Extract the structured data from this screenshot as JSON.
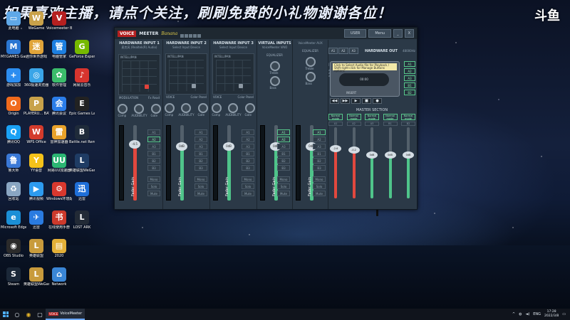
{
  "overlay": {
    "banner": "如果喜欢主播，请点个关注，刷刷免费的小礼物谢谢各位！",
    "logo": "斗鱼"
  },
  "desktop_icons": [
    {
      "label": "此电脑",
      "color": "#5fa8e8",
      "glyph": "▭",
      "col": 0,
      "row": 0
    },
    {
      "label": "WeGame",
      "color": "#c9a24a",
      "glyph": "W",
      "col": 1,
      "row": 0
    },
    {
      "label": "Voicemeeter Banana",
      "color": "#b52020",
      "glyph": "V",
      "col": 2,
      "row": 0
    },
    {
      "label": "MY.GAMES GameCenter",
      "color": "#2a76d2",
      "glyph": "M",
      "col": 0,
      "row": 1
    },
    {
      "label": "迷你世界游戏",
      "color": "#e0a43a",
      "glyph": "迷",
      "col": 1,
      "row": 1
    },
    {
      "label": "电脑管家",
      "color": "#1d7fe0",
      "glyph": "管",
      "col": 2,
      "row": 1
    },
    {
      "label": "GeForce Experience",
      "color": "#76b900",
      "glyph": "G",
      "col": 3,
      "row": 1
    },
    {
      "label": "游戏加加",
      "color": "#2c8df0",
      "glyph": "+",
      "col": 0,
      "row": 2
    },
    {
      "label": "360极速浏览器",
      "color": "#3aa5e8",
      "glyph": "◎",
      "col": 1,
      "row": 2
    },
    {
      "label": "软件管理",
      "color": "#3bbd6b",
      "glyph": "✿",
      "col": 2,
      "row": 2
    },
    {
      "label": "网易云音乐",
      "color": "#d7342e",
      "glyph": "♪",
      "col": 3,
      "row": 2
    },
    {
      "label": "Origin",
      "color": "#f06a1c",
      "glyph": "O",
      "col": 0,
      "row": 3
    },
    {
      "label": "PLAYERU... BATTLEGR...",
      "color": "#c8a24a",
      "glyph": "P",
      "col": 1,
      "row": 3
    },
    {
      "label": "腾讯会议",
      "color": "#2b7de9",
      "glyph": "会",
      "col": 2,
      "row": 3
    },
    {
      "label": "Epic Games Launcher",
      "color": "#222222",
      "glyph": "E",
      "col": 3,
      "row": 3
    },
    {
      "label": "腾讯QQ",
      "color": "#1aa1f5",
      "glyph": "Q",
      "col": 0,
      "row": 4
    },
    {
      "label": "WPS Office",
      "color": "#d33b2c",
      "glyph": "W",
      "col": 1,
      "row": 4
    },
    {
      "label": "雷神加速器",
      "color": "#e9a22a",
      "glyph": "雷",
      "col": 2,
      "row": 4
    },
    {
      "label": "Battle.net Remaster...",
      "color": "#1f2b3a",
      "glyph": "B",
      "col": 3,
      "row": 4
    },
    {
      "label": "鲁大师",
      "color": "#3a78d6",
      "glyph": "鲁",
      "col": 0,
      "row": 5
    },
    {
      "label": "YY语音",
      "color": "#f4c21a",
      "glyph": "Y",
      "col": 1,
      "row": 5
    },
    {
      "label": "网易UU加速器",
      "color": "#2bb673",
      "glyph": "UU",
      "col": 2,
      "row": 5
    },
    {
      "label": "英雄联盟WeGame版",
      "color": "#1f3c64",
      "glyph": "L",
      "col": 3,
      "row": 5
    },
    {
      "label": "回收站",
      "color": "#8aa6c2",
      "glyph": "♻",
      "col": 0,
      "row": 6
    },
    {
      "label": "腾讯视频",
      "color": "#2d9bef",
      "glyph": "▶",
      "col": 1,
      "row": 6
    },
    {
      "label": "Windows环境配置",
      "color": "#d8382e",
      "glyph": "⚙",
      "col": 2,
      "row": 6
    },
    {
      "label": "迅雷",
      "color": "#1f6fd8",
      "glyph": "迅",
      "col": 3,
      "row": 6
    },
    {
      "label": "Microsoft Edge",
      "color": "#1b8fd6",
      "glyph": "e",
      "col": 0,
      "row": 7
    },
    {
      "label": "迅雷",
      "color": "#2a7be0",
      "glyph": "✈",
      "col": 1,
      "row": 7
    },
    {
      "label": "在线使用手册",
      "color": "#cc3a2c",
      "glyph": "书",
      "col": 2,
      "row": 7
    },
    {
      "label": "LOST ARK",
      "color": "#222a36",
      "glyph": "L",
      "col": 3,
      "row": 7
    },
    {
      "label": "OBS Studio",
      "color": "#2b2b2b",
      "glyph": "◉",
      "col": 0,
      "row": 8
    },
    {
      "label": "英雄联盟",
      "color": "#c89b3c",
      "glyph": "L",
      "col": 1,
      "row": 8
    },
    {
      "label": "2020",
      "color": "#e3b038",
      "glyph": "▤",
      "col": 2,
      "row": 8
    },
    {
      "label": "Steam",
      "color": "#1b2838",
      "glyph": "S",
      "col": 0,
      "row": 9
    },
    {
      "label": "英雄联盟WeGame版",
      "color": "#c89b3c",
      "glyph": "L",
      "col": 1,
      "row": 9
    },
    {
      "label": "Network",
      "color": "#3a86d6",
      "glyph": "⌂",
      "col": 2,
      "row": 9
    }
  ],
  "voicemeeter": {
    "brand": "VOICE",
    "brand2": "MEETER",
    "variant": "Banana",
    "user_btn": "USER",
    "menu_btn": "Menu",
    "minimize": "_",
    "close": "X",
    "strips": [
      {
        "title": "HARDWARE INPUT 1",
        "device": "麦克风 (Realtek(R) Audio)",
        "intelli": "INTELLIPAN",
        "mode": "MODULATION",
        "mode2": "Fx Read",
        "knob1": "Comp",
        "knob2": "AUDIBILITY",
        "knob3": "Gate",
        "gain": "-4.5",
        "fill": "#e2483e",
        "level": 0.78,
        "routes": [
          "A1",
          "A2",
          "A3",
          "B1",
          "B2",
          "B3",
          "Mono",
          "Solo",
          "Mute"
        ],
        "on": [
          1
        ]
      },
      {
        "title": "HARDWARE INPUT 2",
        "device": "Select Input Device",
        "intelli": "INTELLIPAN",
        "mode": "VOICE",
        "mode2": "Color Panel",
        "knob1": "Comp",
        "knob2": "AUDIBILITY",
        "knob3": "Gate",
        "gain": "0dB",
        "fill": "#4fc48a",
        "level": 0.74,
        "routes": [
          "A1",
          "A2",
          "A3",
          "B1",
          "B2",
          "B3",
          "Mono",
          "Solo",
          "Mute"
        ],
        "on": []
      },
      {
        "title": "HARDWARE INPUT 3",
        "device": "Select Input Device",
        "intelli": "INTELLIPAN",
        "mode": "VOICE",
        "mode2": "Color Panel",
        "knob1": "Comp",
        "knob2": "AUDIBILITY",
        "knob3": "Gate",
        "gain": "0dB",
        "fill": "#4fc48a",
        "level": 0.74,
        "routes": [
          "A1",
          "A2",
          "A3",
          "B1",
          "B2",
          "B3",
          "Mono",
          "Solo",
          "Mute"
        ],
        "on": []
      },
      {
        "title": "VIRTUAL INPUTS",
        "device": "VoiceMeeter VAIO",
        "intelli": "EQUALIZER",
        "mode": "Treble",
        "mode2": "Bass",
        "knob1": "",
        "knob2": "",
        "knob3": "",
        "gain": "0dB",
        "fill": "#4fc48a",
        "level": 0.74,
        "routes": [
          "A1",
          "A2",
          "A3",
          "B1",
          "B2",
          "B3",
          "Mono",
          "Solo",
          "Mute"
        ],
        "on": [
          0,
          1
        ]
      },
      {
        "title": "",
        "device": "VoiceMeeter AUX",
        "intelli": "EQUALIZER",
        "mode": "Treble",
        "mode2": "Bass",
        "knob1": "",
        "knob2": "",
        "knob3": "",
        "gain": "0dB",
        "fill": "#4fc48a",
        "level": 0.74,
        "routes": [
          "A1",
          "A2",
          "A3",
          "B1",
          "B2",
          "B3",
          "Mono",
          "Solo",
          "Mute"
        ],
        "on": [
          0
        ]
      }
    ],
    "hardware_out": {
      "title": "HARDWARE OUT",
      "spec": "48000Hz | 512",
      "devices": [
        "A1: 耳机 (Realtek(R) Audio)",
        "A2: VAIO3 (VB-Audio...)",
        "A3: 扬声器 (NVIDIA High Definition Audio)"
      ],
      "a_buttons": [
        "A1",
        "A2",
        "A3"
      ],
      "tape_note": "Click to Select Audio file for Playback / Shift-right-click for Manage Buttons options",
      "tape_time": "00:00",
      "tape_label": "INSERT",
      "ctrls": [
        "◀◀",
        "▶▶",
        "▶",
        "■",
        "●"
      ],
      "bus_buttons": [
        "A1",
        "A2",
        "A3",
        "B1",
        "B2"
      ],
      "master_label": "MASTER SECTION",
      "modes": [
        "Normal mode",
        "Normal mode",
        "Normal mode",
        "Normal mode",
        "Normal mode"
      ],
      "columns": [
        "A1",
        "A2",
        "A3",
        "B1",
        "B2"
      ],
      "gains": [
        {
          "val": "-2.6",
          "fill": "#e2483e",
          "level": 0.72
        },
        {
          "val": "-0.2",
          "fill": "#e2483e",
          "level": 0.7
        },
        {
          "val": "0dB",
          "fill": "#4fc48a",
          "level": 0.62
        },
        {
          "val": "0dB",
          "fill": "#4fc48a",
          "level": 0.62
        },
        {
          "val": "0dB",
          "fill": "#4fc48a",
          "level": 0.62
        }
      ],
      "fader_label": "Fader Gain"
    }
  },
  "taskbar": {
    "app_label": "VoiceMeeter",
    "app_icon": "VOICE",
    "tray_lang": "ENG",
    "time": "17:28",
    "date": "2022/3/8"
  }
}
